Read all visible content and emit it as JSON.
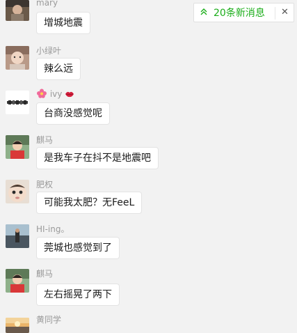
{
  "banner": {
    "text": "20条新消息",
    "up_icon": "double-chevron-up-icon",
    "close_glyph": "✕"
  },
  "messages": [
    {
      "sender": "mary",
      "text": "增城地震"
    },
    {
      "sender": "小绿叶",
      "text": "辣么远"
    },
    {
      "sender": "ivy",
      "text": "台商没感觉呢"
    },
    {
      "sender": "麒马",
      "text": "是我车子在抖不是地震吧"
    },
    {
      "sender": "肥权",
      "text": "可能我太肥？无FeeL"
    },
    {
      "sender": "HI-ing。",
      "text": "莞城也感觉到了"
    },
    {
      "sender": "麒马",
      "text": "左右摇晃了两下"
    },
    {
      "sender": "黄同学",
      "text": ""
    }
  ]
}
